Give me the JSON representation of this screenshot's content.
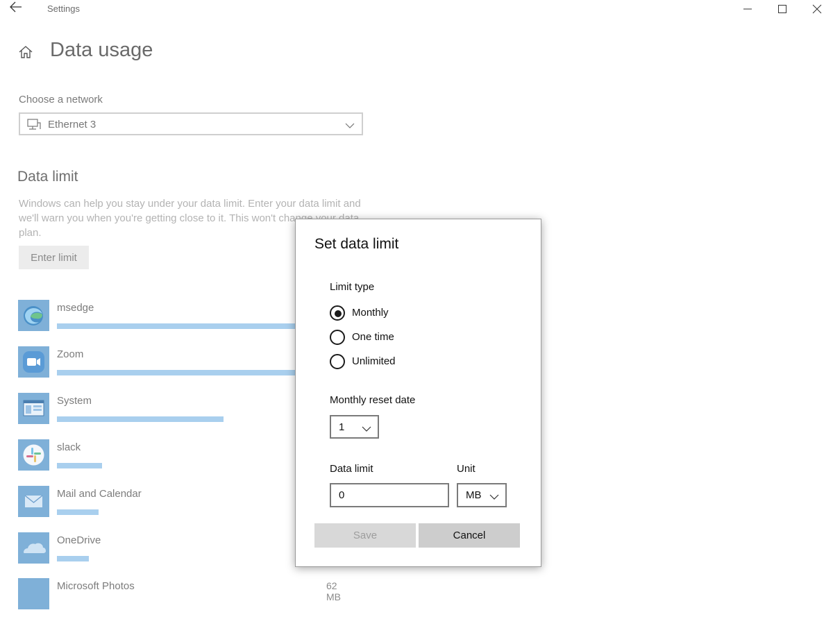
{
  "window": {
    "title": "Settings"
  },
  "page": {
    "title": "Data usage"
  },
  "network": {
    "label": "Choose a network",
    "selected": "Ethernet 3"
  },
  "data_limit_section": {
    "title": "Data limit",
    "description": "Windows can help you stay under your data limit. Enter your data limit and we'll warn you when you're getting close to it. This won't change your data plan.",
    "button": "Enter limit"
  },
  "apps": [
    {
      "name": "msedge",
      "usage_fraction": 1.0,
      "icon": "edge-icon"
    },
    {
      "name": "Zoom",
      "usage_fraction": 1.0,
      "icon": "zoom-icon"
    },
    {
      "name": "System",
      "usage_fraction": 0.52,
      "icon": "system-icon"
    },
    {
      "name": "slack",
      "usage_fraction": 0.14,
      "icon": "slack-icon"
    },
    {
      "name": "Mail and Calendar",
      "usage_fraction": 0.13,
      "icon": "mail-icon"
    },
    {
      "name": "OneDrive",
      "usage_fraction": 0.1,
      "icon": "onedrive-icon"
    },
    {
      "name": "Microsoft Photos",
      "size": "62 MB",
      "icon": "photos-icon"
    }
  ],
  "dialog": {
    "title": "Set data limit",
    "limit_type_label": "Limit type",
    "options": [
      "Monthly",
      "One time",
      "Unlimited"
    ],
    "selected_option": "Monthly",
    "reset_date_label": "Monthly reset date",
    "reset_date_value": "1",
    "data_limit_label": "Data limit",
    "data_limit_value": "0",
    "unit_label": "Unit",
    "unit_value": "MB",
    "save_label": "Save",
    "cancel_label": "Cancel"
  },
  "colors": {
    "accent_bar": "#a9cfee",
    "icon_tile": "#7fb0d8"
  }
}
